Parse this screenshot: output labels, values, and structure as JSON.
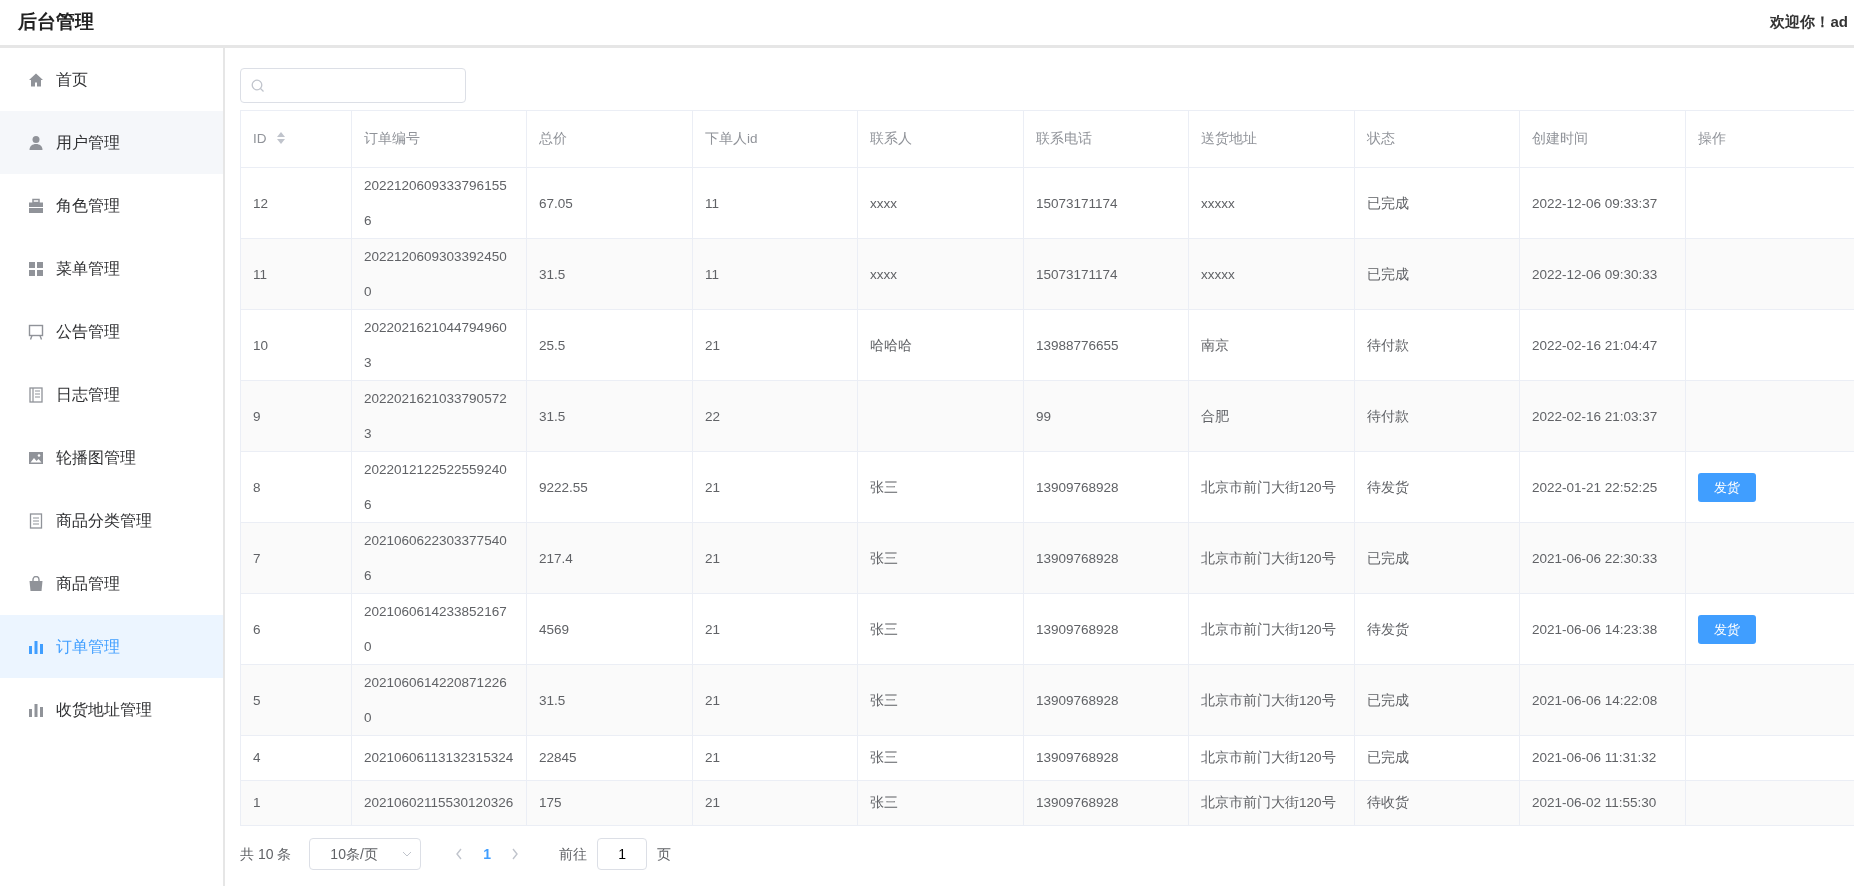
{
  "header": {
    "title": "后台管理",
    "welcome": "欢迎你！ad"
  },
  "sidebar": {
    "items": [
      {
        "label": "首页",
        "selected": false
      },
      {
        "label": "用户管理",
        "selected": false
      },
      {
        "label": "角色管理",
        "selected": false
      },
      {
        "label": "菜单管理",
        "selected": false
      },
      {
        "label": "公告管理",
        "selected": false
      },
      {
        "label": "日志管理",
        "selected": false
      },
      {
        "label": "轮播图管理",
        "selected": false
      },
      {
        "label": "商品分类管理",
        "selected": false
      },
      {
        "label": "商品管理",
        "selected": false
      },
      {
        "label": "订单管理",
        "selected": true
      },
      {
        "label": "收货地址管理",
        "selected": false
      }
    ]
  },
  "table": {
    "columns": [
      "ID",
      "订单编号",
      "总价",
      "下单人id",
      "联系人",
      "联系电话",
      "送货地址",
      "状态",
      "创建时间",
      "操作"
    ],
    "rows": [
      {
        "cells": [
          "12",
          "20221206093337961556",
          "67.05",
          "11",
          "xxxx",
          "15073171174",
          "xxxxx",
          "已完成",
          "2022-12-06 09:33:37"
        ]
      },
      {
        "cells": [
          "11",
          "20221206093033924500",
          "31.5",
          "11",
          "xxxx",
          "15073171174",
          "xxxxx",
          "已完成",
          "2022-12-06 09:30:33"
        ]
      },
      {
        "cells": [
          "10",
          "20220216210447949603",
          "25.5",
          "21",
          "哈哈哈",
          "13988776655",
          "南京",
          "待付款",
          "2022-02-16 21:04:47"
        ]
      },
      {
        "cells": [
          "9",
          "20220216210337905723",
          "31.5",
          "22",
          "",
          "99",
          "合肥",
          "待付款",
          "2022-02-16 21:03:37"
        ]
      },
      {
        "cells": [
          "8",
          "20220121225225592406",
          "9222.55",
          "21",
          "张三",
          "13909768928",
          "北京市前门大街120号",
          "待发货",
          "2022-01-21 22:52:25"
        ],
        "action": "发货"
      },
      {
        "cells": [
          "7",
          "20210606223033775406",
          "217.4",
          "21",
          "张三",
          "13909768928",
          "北京市前门大街120号",
          "已完成",
          "2021-06-06 22:30:33"
        ]
      },
      {
        "cells": [
          "6",
          "20210606142338521670",
          "4569",
          "21",
          "张三",
          "13909768928",
          "北京市前门大街120号",
          "待发货",
          "2021-06-06 14:23:38"
        ],
        "action": "发货"
      },
      {
        "cells": [
          "5",
          "20210606142208712260",
          "31.5",
          "21",
          "张三",
          "13909768928",
          "北京市前门大街120号",
          "已完成",
          "2021-06-06 14:22:08"
        ]
      },
      {
        "cells": [
          "4",
          "20210606113132315324",
          "22845",
          "21",
          "张三",
          "13909768928",
          "北京市前门大街120号",
          "已完成",
          "2021-06-06 11:31:32"
        ]
      },
      {
        "cells": [
          "1",
          "20210602115530120326",
          "175",
          "21",
          "张三",
          "13909768928",
          "北京市前门大街120号",
          "待收货",
          "2021-06-02 11:55:30"
        ]
      }
    ]
  },
  "pagination": {
    "total": "共 10 条",
    "page_size": "10条/页",
    "pages": [
      {
        "label": "1",
        "selected": true
      }
    ],
    "goto_label": "前往",
    "goto_value": "1",
    "goto_unit": "页"
  }
}
